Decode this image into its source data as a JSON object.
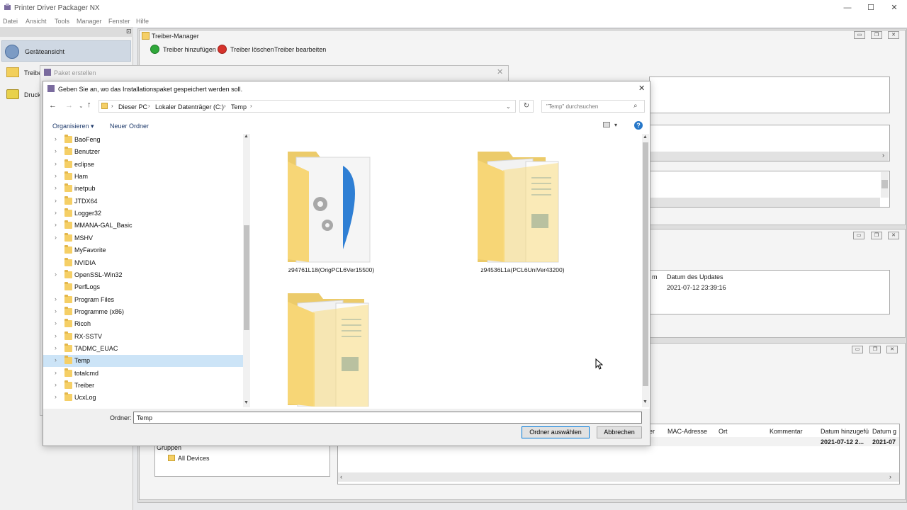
{
  "app": {
    "title": "Printer Driver Packager NX",
    "controls": [
      "—",
      "☐",
      "✕"
    ]
  },
  "menu": [
    "Datei",
    "Ansicht",
    "Tools",
    "Manager",
    "Fenster",
    "Hilfe"
  ],
  "sidebar": {
    "items": [
      {
        "label": "Geräteansicht",
        "icon": "devices-icon"
      },
      {
        "label": "Treibe",
        "icon": "folder-icon"
      },
      {
        "label": "Druck",
        "icon": "printer-icon"
      }
    ]
  },
  "driver_manager": {
    "title": "Treiber-Manager",
    "add_label": "Treiber hinzufügen",
    "delete_label": "Treiber löschen",
    "edit_label": "Treiber bearbeiten"
  },
  "update_panel": {
    "col_suffix": "m",
    "col_header": "Datum des Updates",
    "value": "2021-07-12 23:39:16"
  },
  "device_panel": {
    "columns": [
      "er",
      "MAC-Adresse",
      "Ort",
      "Kommentar",
      "Datum hinzugefü",
      "Datum g"
    ],
    "row": [
      "",
      "",
      "",
      "",
      "2021-07-12 2...",
      "2021-07"
    ],
    "groups_label": "Gruppen",
    "all_devices": "All Devices"
  },
  "paket_window": {
    "title": "Paket erstellen"
  },
  "dialog": {
    "title": "Geben Sie an, wo das Installationspaket gespeichert werden soll.",
    "breadcrumb": [
      "Dieser PC",
      "Lokaler Datenträger (C:)",
      "Temp"
    ],
    "search_placeholder": "\"Temp\" durchsuchen",
    "organize_label": "Organisieren",
    "new_folder_label": "Neuer Ordner",
    "tree": [
      "BaoFeng",
      "Benutzer",
      "eclipse",
      "Ham",
      "inetpub",
      "JTDX64",
      "Logger32",
      "MMANA-GAL_Basic",
      "MSHV",
      "MyFavorite",
      "NVIDIA",
      "OpenSSL-Win32",
      "PerfLogs",
      "Program Files",
      "Programme (x86)",
      "Ricoh",
      "RX-SSTV",
      "TADMC_EUAC",
      "Temp",
      "totalcmd",
      "Treiber",
      "UcxLog"
    ],
    "tree_selected": "Temp",
    "tree_has_children": [
      true,
      true,
      true,
      true,
      true,
      true,
      true,
      true,
      true,
      false,
      false,
      true,
      false,
      true,
      true,
      true,
      true,
      true,
      true,
      true,
      true,
      true
    ],
    "files": [
      {
        "name": "z94761L18(OrigPCL6Ver15500)",
        "icon": "installer-folder-icon"
      },
      {
        "name": "z94536L1a(PCL6UniVer43200)",
        "icon": "document-folder-icon"
      },
      {
        "name": "",
        "icon": "document-folder-icon"
      }
    ],
    "folder_label": "Ordner:",
    "folder_value": "Temp",
    "select_label": "Ordner auswählen",
    "cancel_label": "Abbrechen"
  }
}
